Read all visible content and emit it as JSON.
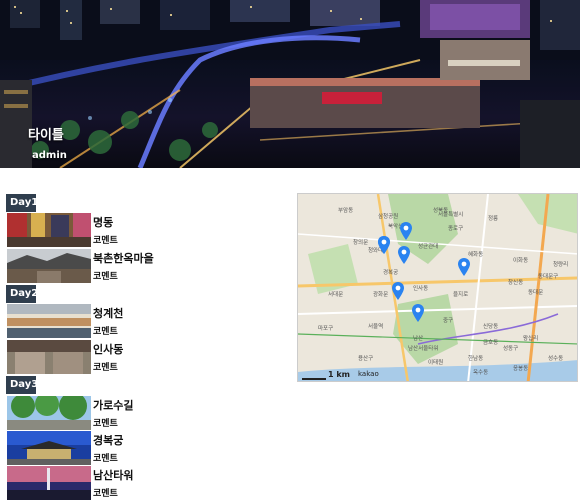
{
  "post": {
    "title": "타이틀",
    "author": "admin"
  },
  "days": [
    {
      "label": "Day1",
      "places": [
        {
          "name": "명동",
          "comment": "코멘트"
        },
        {
          "name": "북촌한옥마을",
          "comment": "코멘트"
        }
      ]
    },
    {
      "label": "Day2",
      "places": [
        {
          "name": "청계천",
          "comment": "코멘트"
        },
        {
          "name": "인사동",
          "comment": "코멘트"
        }
      ]
    },
    {
      "label": "Day3",
      "places": [
        {
          "name": "가로수길",
          "comment": "코멘트"
        },
        {
          "name": "경복궁",
          "comment": "코멘트"
        },
        {
          "name": "남산타워",
          "comment": "코멘트"
        }
      ]
    }
  ],
  "map": {
    "scale_label": "1 km",
    "brand": "kakao",
    "marker_color": "#2a83f0",
    "labels": [
      "부암동",
      "종로구",
      "성북동",
      "삼청공원",
      "창의문",
      "청와대",
      "성균관대",
      "북악산",
      "서울특별시",
      "정릉",
      "경복궁",
      "혜화동",
      "이화동",
      "창신동",
      "동대문",
      "서대문",
      "광화문",
      "인사동",
      "을지로",
      "서울역",
      "중구",
      "남산",
      "남산서울타워",
      "신당동",
      "동대문구",
      "청량리",
      "마포구",
      "용산구",
      "이태원",
      "한남동",
      "성동구",
      "왕십리",
      "금호동",
      "응봉동",
      "옥수동",
      "성수동"
    ]
  }
}
